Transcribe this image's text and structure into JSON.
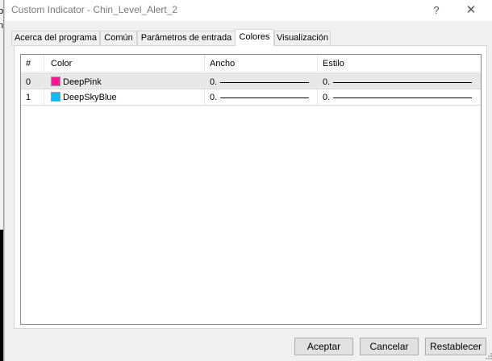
{
  "behind": {
    "fragment_top": "b",
    "fragment_mid": "n"
  },
  "window": {
    "title": "Custom Indicator - Chin_Level_Alert_2",
    "help_glyph": "?",
    "close_glyph": "✕"
  },
  "tabs": [
    {
      "label": "Acerca del programa",
      "active": false
    },
    {
      "label": "Común",
      "active": false
    },
    {
      "label": "Parámetros de entrada",
      "active": false
    },
    {
      "label": "Colores",
      "active": true
    },
    {
      "label": "Visualización",
      "active": false
    }
  ],
  "table": {
    "headers": {
      "index": "#",
      "color": "Color",
      "width": "Ancho",
      "style": "Estilo"
    },
    "rows": [
      {
        "index": "0",
        "color_name": "DeepPink",
        "color_hex": "#ff1493",
        "width": "0.",
        "style": "0.",
        "selected": true
      },
      {
        "index": "1",
        "color_name": "DeepSkyBlue",
        "color_hex": "#00bfff",
        "width": "0.",
        "style": "0.",
        "selected": false
      }
    ]
  },
  "buttons": {
    "ok": "Aceptar",
    "cancel": "Cancelar",
    "reset": "Restablecer"
  }
}
